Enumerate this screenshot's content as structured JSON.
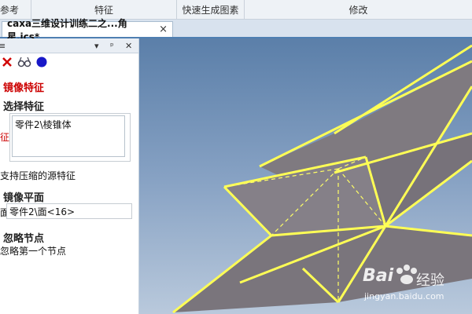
{
  "ribbon": {
    "groups": [
      "参考",
      "特征",
      "快速生成图素",
      "修改"
    ]
  },
  "document_tab": {
    "title": "caxa三维设计训练二之...角星.ics*",
    "close": "×"
  },
  "panel": {
    "title_char": "≡",
    "controls": {
      "dropdown": "▾",
      "pin": "ᵖ",
      "close": "✕"
    },
    "mirror_feature_heading": "镜像特征",
    "select_feature_heading": "选择特征",
    "feature_side_label": "征",
    "feature_list": [
      "零件2\\棱锥体"
    ],
    "support_compressed_label": "支持压缩的源特征",
    "mirror_plane_heading": "镜像平面",
    "plane_side_label": "面",
    "plane_value": "零件2\\面<16>",
    "ignore_node_heading": "忽略节点",
    "ignore_first_node_label": "忽略第一个节点"
  },
  "colors": {
    "accent_red": "#cc0000",
    "wire_yellow": "#ffff55",
    "solid_gray": "#7f7a80"
  },
  "watermark": {
    "brand": "Bai",
    "brand_suffix": "经验",
    "url": "jingyan.baidu.com"
  }
}
